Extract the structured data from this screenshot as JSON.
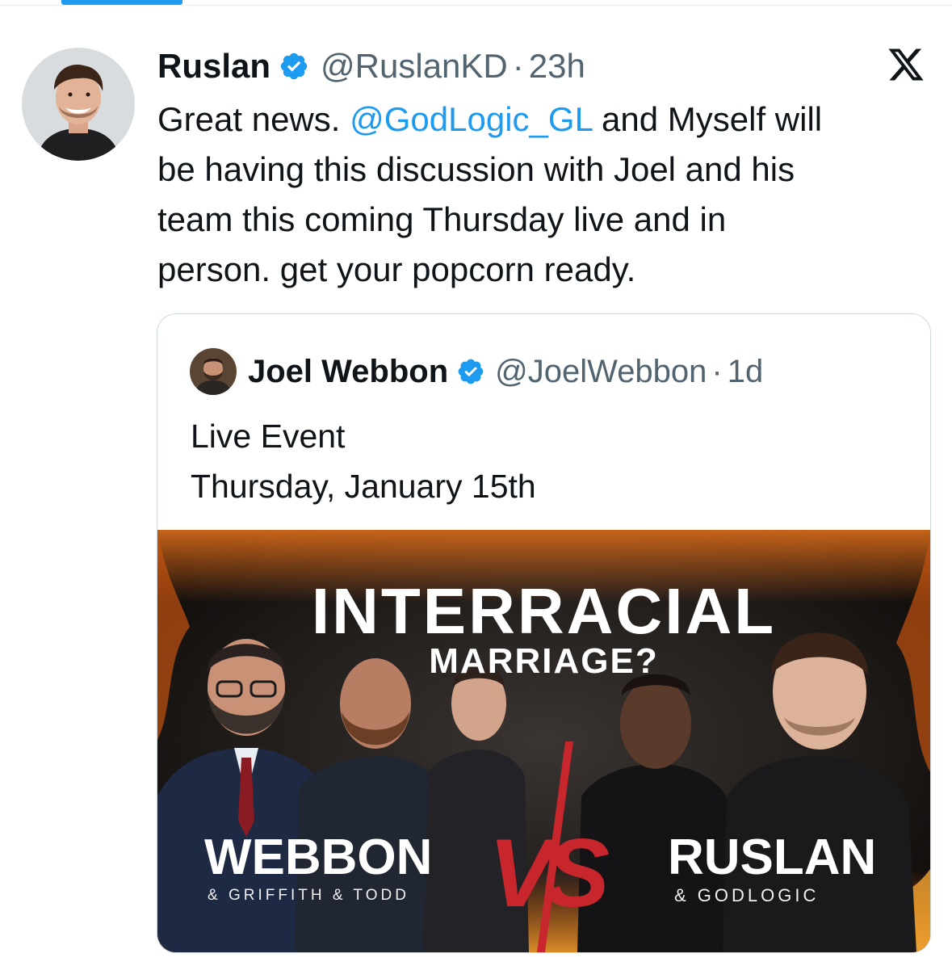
{
  "tweet": {
    "author_name": "Ruslan",
    "handle": "@RuslanKD",
    "separator": "·",
    "time": "23h",
    "text_lines": [
      {
        "before": "Great news. ",
        "mention": "@GodLogic_GL",
        "after": " and Myself will"
      },
      "be having this discussion with Joel and his",
      "team this coming Thursday live and in",
      "person. get your popcorn ready."
    ]
  },
  "quote": {
    "author_name": "Joel Webbon",
    "handle": "@JoelWebbon",
    "separator": "·",
    "time": "1d",
    "text_lines": [
      "Live Event",
      "Thursday, January 15th"
    ],
    "media": {
      "headline": "INTERRACIAL",
      "subheadline": "MARRIAGE?",
      "left_name": "WEBBON",
      "left_sub": "& GRIFFITH & TODD",
      "versus": "VS",
      "right_name": "RUSLAN",
      "right_sub": "& GODLOGIC"
    }
  },
  "colors": {
    "link": "#1d9bf0",
    "verified": "#1d9bf0",
    "muted": "#536471",
    "versus": "#c8262d"
  },
  "icons": [
    "verified-badge-icon",
    "x-logo-icon"
  ]
}
